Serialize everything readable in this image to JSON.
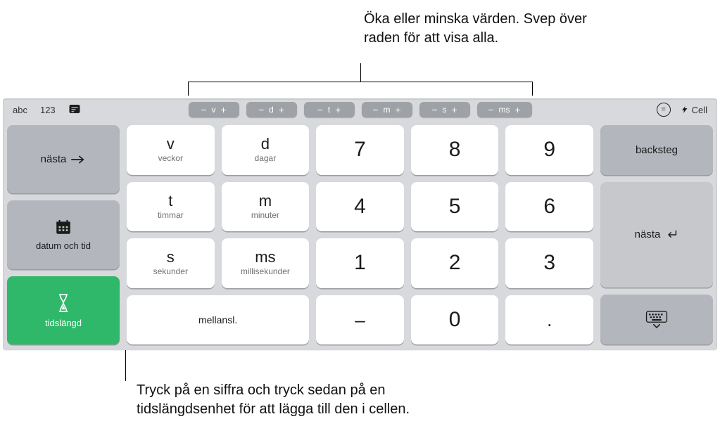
{
  "annotations": {
    "top": "Öka eller minska värden. Svep över raden för att visa alla.",
    "bottom": "Tryck på en siffra och tryck sedan på en tidslängdsenhet för att lägga till den i cellen."
  },
  "topbar": {
    "left": {
      "abc": "abc",
      "num": "123"
    },
    "center_units": [
      {
        "label": "v"
      },
      {
        "label": "d"
      },
      {
        "label": "t"
      },
      {
        "label": "m"
      },
      {
        "label": "s"
      },
      {
        "label": "ms"
      }
    ],
    "right": {
      "equals": "=",
      "cell": "Cell"
    }
  },
  "left_col": {
    "next": "nästa",
    "datetime": "datum och tid",
    "duration": "tidslängd"
  },
  "units": [
    {
      "main": "v",
      "sub": "veckor"
    },
    {
      "main": "d",
      "sub": "dagar"
    },
    {
      "main": "t",
      "sub": "timmar"
    },
    {
      "main": "m",
      "sub": "minuter"
    },
    {
      "main": "s",
      "sub": "sekunder"
    },
    {
      "main": "ms",
      "sub": "millisekunder"
    }
  ],
  "numpad": {
    "r1": [
      "7",
      "8",
      "9"
    ],
    "r2": [
      "4",
      "5",
      "6"
    ],
    "r3": [
      "1",
      "2",
      "3"
    ],
    "r4_minus": "–",
    "r4_zero": "0",
    "r4_dot": "."
  },
  "bottom_row": {
    "spacebar": "mellansl."
  },
  "right_col": {
    "backspace": "backsteg",
    "next": "nästa"
  }
}
